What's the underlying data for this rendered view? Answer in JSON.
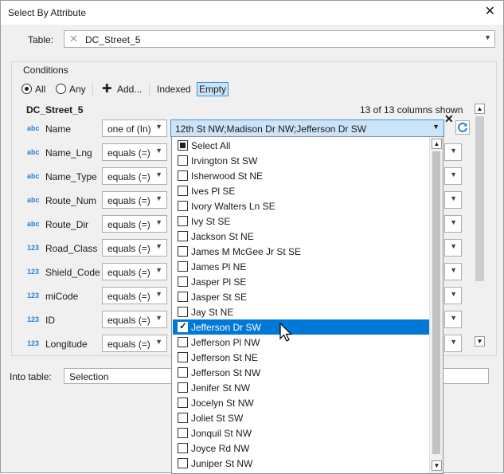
{
  "window": {
    "title": "Select By Attribute"
  },
  "table": {
    "label": "Table:",
    "value": "DC_Street_5"
  },
  "conditions": {
    "label": "Conditions",
    "all_label": "All",
    "any_label": "Any",
    "add_label": "Add...",
    "indexed_label": "Indexed",
    "empty_label": "Empty",
    "layer_name": "DC_Street_5",
    "columns_shown": "13 of 13 columns shown"
  },
  "rows": [
    {
      "type": "abc",
      "name": "Name",
      "op": "one of (In)"
    },
    {
      "type": "abc",
      "name": "Name_Lng",
      "op": "equals (=)"
    },
    {
      "type": "abc",
      "name": "Name_Type",
      "op": "equals (=)"
    },
    {
      "type": "abc",
      "name": "Route_Num",
      "op": "equals (=)"
    },
    {
      "type": "abc",
      "name": "Route_Dir",
      "op": "equals (=)"
    },
    {
      "type": "123",
      "name": "Road_Class",
      "op": "equals (=)"
    },
    {
      "type": "123",
      "name": "Shield_Code",
      "op": "equals (=)"
    },
    {
      "type": "123",
      "name": "miCode",
      "op": "equals (=)"
    },
    {
      "type": "123",
      "name": "ID",
      "op": "equals (=)"
    },
    {
      "type": "123",
      "name": "Longitude",
      "op": "equals (=)"
    }
  ],
  "value_selected": "12th St NW;Madison Dr NW;Jefferson Dr SW",
  "dropdown_items": [
    {
      "label": "Select All",
      "state": "indeterminate"
    },
    {
      "label": "Irvington St SW",
      "state": "unchecked"
    },
    {
      "label": "Isherwood St NE",
      "state": "unchecked"
    },
    {
      "label": "Ives Pl SE",
      "state": "unchecked"
    },
    {
      "label": "Ivory Walters Ln SE",
      "state": "unchecked"
    },
    {
      "label": "Ivy St SE",
      "state": "unchecked"
    },
    {
      "label": "Jackson St NE",
      "state": "unchecked"
    },
    {
      "label": "James M McGee Jr St SE",
      "state": "unchecked"
    },
    {
      "label": "James Pl NE",
      "state": "unchecked"
    },
    {
      "label": "Jasper Pl SE",
      "state": "unchecked"
    },
    {
      "label": "Jasper St SE",
      "state": "unchecked"
    },
    {
      "label": "Jay St NE",
      "state": "unchecked"
    },
    {
      "label": "Jefferson Dr SW",
      "state": "checked",
      "highlighted": true
    },
    {
      "label": "Jefferson Pl NW",
      "state": "unchecked"
    },
    {
      "label": "Jefferson St NE",
      "state": "unchecked"
    },
    {
      "label": "Jefferson St NW",
      "state": "unchecked"
    },
    {
      "label": "Jenifer St NW",
      "state": "unchecked"
    },
    {
      "label": "Jocelyn St NW",
      "state": "unchecked"
    },
    {
      "label": "Joliet St SW",
      "state": "unchecked"
    },
    {
      "label": "Jonquil St NW",
      "state": "unchecked"
    },
    {
      "label": "Joyce Rd NW",
      "state": "unchecked"
    },
    {
      "label": "Juniper St NW",
      "state": "unchecked"
    }
  ],
  "into": {
    "label": "Into table:",
    "value": "Selection"
  },
  "icons": {
    "close": "close-icon",
    "add": "plus-icon",
    "refresh": "refresh-icon",
    "remove": "remove-x-icon"
  },
  "colors": {
    "selection": "#0078d7",
    "highlight": "#cce4f7",
    "type_icon": "#2a7fd4"
  }
}
